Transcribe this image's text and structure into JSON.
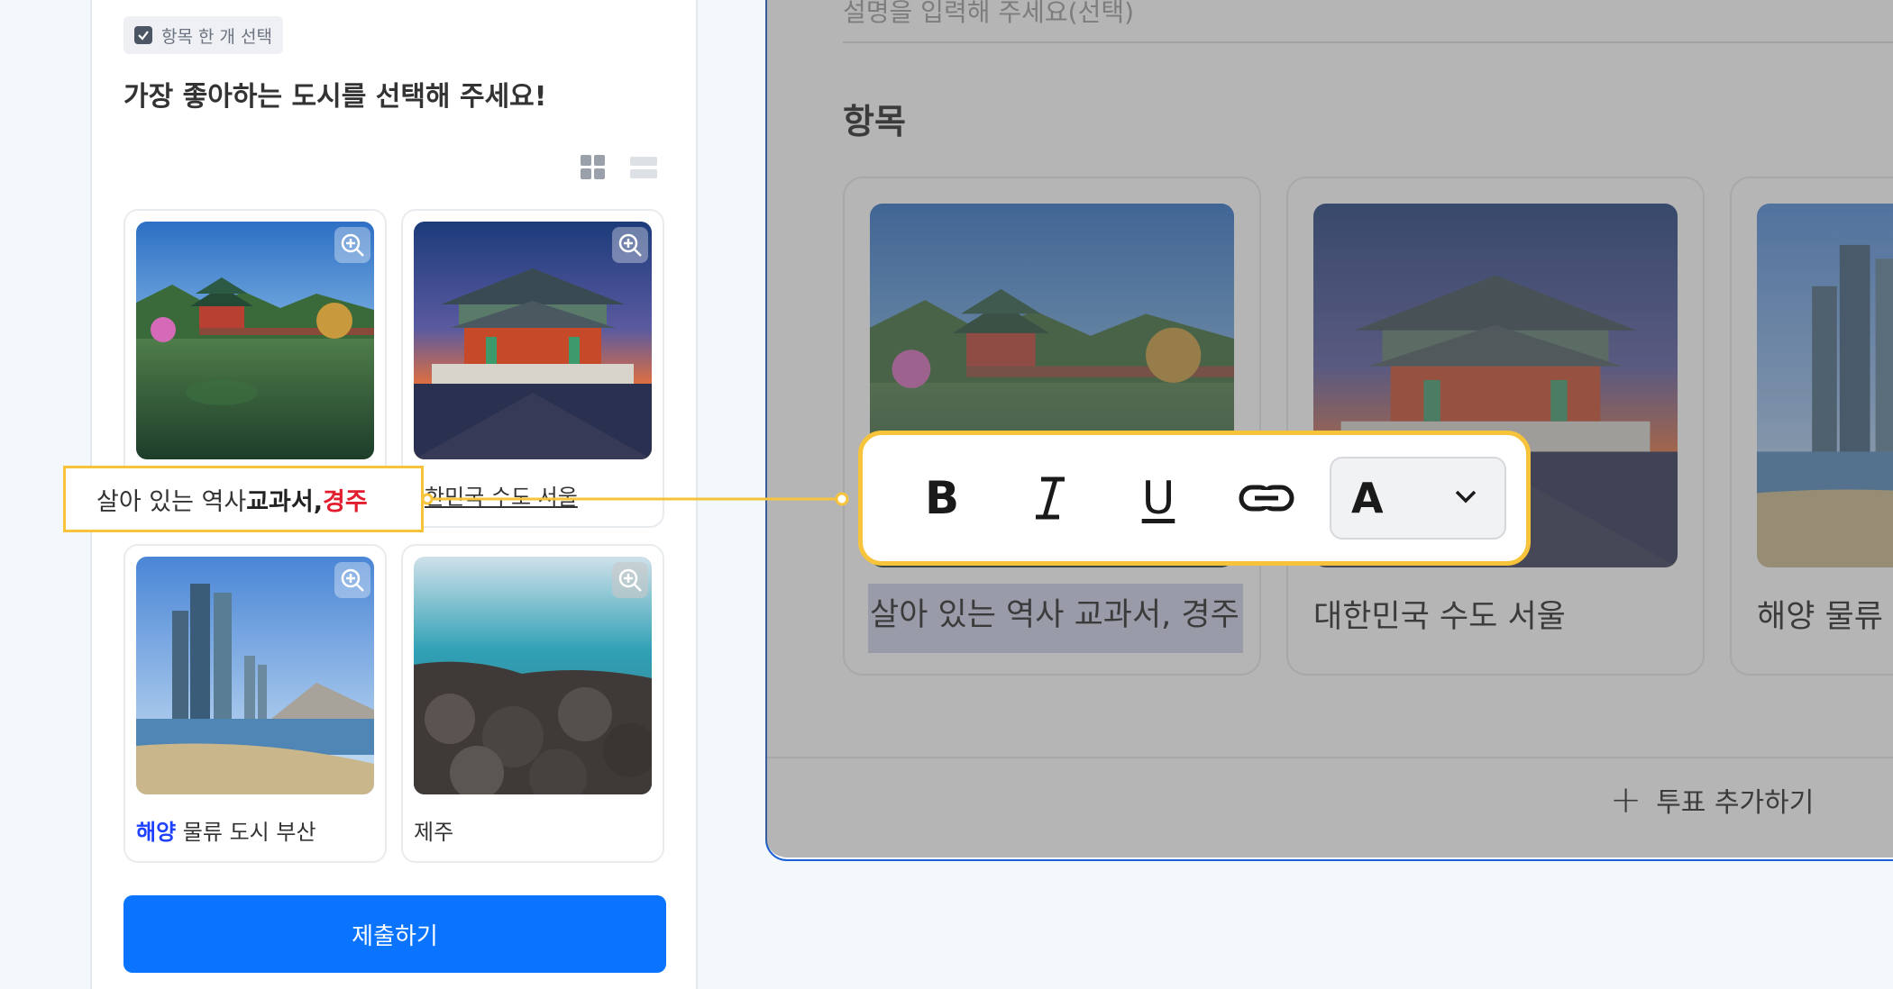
{
  "preview": {
    "type_badge": "항목 한 개 선택",
    "question_title": "가장 좋아하는 도시를 선택해 주세요!",
    "options": [
      {
        "label": "살아 있는 역사 교과서, 경주"
      },
      {
        "label": "한민국 수도 서울"
      },
      {
        "label_highlight": "해양",
        "label_rest": " 물류 도시 부산"
      },
      {
        "label": "제주"
      }
    ],
    "submit_label": "제출하기"
  },
  "callout": {
    "part1": "살아 있는 역사 ",
    "part2_bold": "교과서, ",
    "part3_red": "경주"
  },
  "editor": {
    "description_placeholder": "설명을 입력해 주세요(선택)",
    "section_title": "항목",
    "cards": [
      {
        "label": "살아 있는 역사 교과서, 경주"
      },
      {
        "label": "대한민국 수도 서울"
      },
      {
        "label": "해양 물류 도"
      }
    ],
    "add_vote_label": "투표 추가하기"
  },
  "toolbar": {
    "bold": "B",
    "italic": "I",
    "underline": "U",
    "color_letter": "A",
    "icons": [
      "bold-icon",
      "italic-icon",
      "underline-icon",
      "link-icon",
      "text-color-icon",
      "chevron-down-icon"
    ]
  },
  "colors": {
    "accent_blue": "#0a74ff",
    "highlight_yellow": "#f6c33a",
    "red_text": "#e11d2e",
    "blue_text": "#1e40ff",
    "editor_border": "#1d5fd6"
  }
}
